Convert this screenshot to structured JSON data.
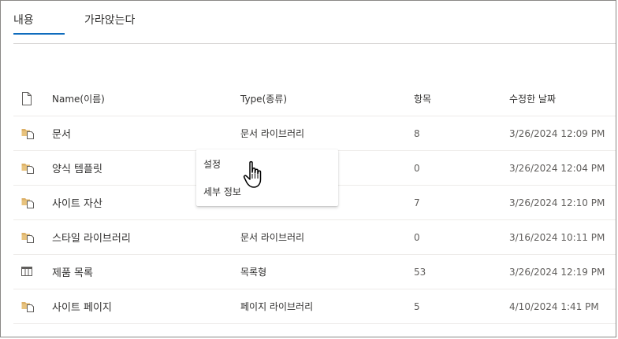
{
  "tabs": [
    {
      "label": "내용",
      "active": true
    },
    {
      "label": "가라앉는다",
      "active": false
    }
  ],
  "table": {
    "columns": [
      "Name(이름)",
      "Type(종류)",
      "항목",
      "수정한 날짜"
    ],
    "rows": [
      {
        "icon": "library-folder-icon",
        "name": "문서",
        "type": "문서 라이브러리",
        "items": "8",
        "modified": "3/26/2024 12:09 PM"
      },
      {
        "icon": "library-folder-icon",
        "name": "양식 템플릿",
        "type": "",
        "items": "0",
        "modified": "3/26/2024 12:04 PM"
      },
      {
        "icon": "library-folder-icon",
        "name": "사이트 자산",
        "type": "",
        "items": "7",
        "modified": "3/26/2024 12:10 PM"
      },
      {
        "icon": "library-folder-icon",
        "name": "스타일 라이브러리",
        "type": "문서 라이브러리",
        "items": "0",
        "modified": "3/16/2024 10:11 PM"
      },
      {
        "icon": "list-table-icon",
        "name": "제품 목록",
        "type": "목록형",
        "items": "53",
        "modified": "3/26/2024 12:19 PM"
      },
      {
        "icon": "library-folder-icon",
        "name": "사이트 페이지",
        "type": "페이지 라이브러리",
        "items": "5",
        "modified": "4/10/2024 1:41 PM"
      }
    ]
  },
  "context_menu": {
    "items": [
      "설정",
      "세부 정보"
    ]
  },
  "colors": {
    "accent": "#0f6cbd",
    "folder": "#dcb067"
  }
}
